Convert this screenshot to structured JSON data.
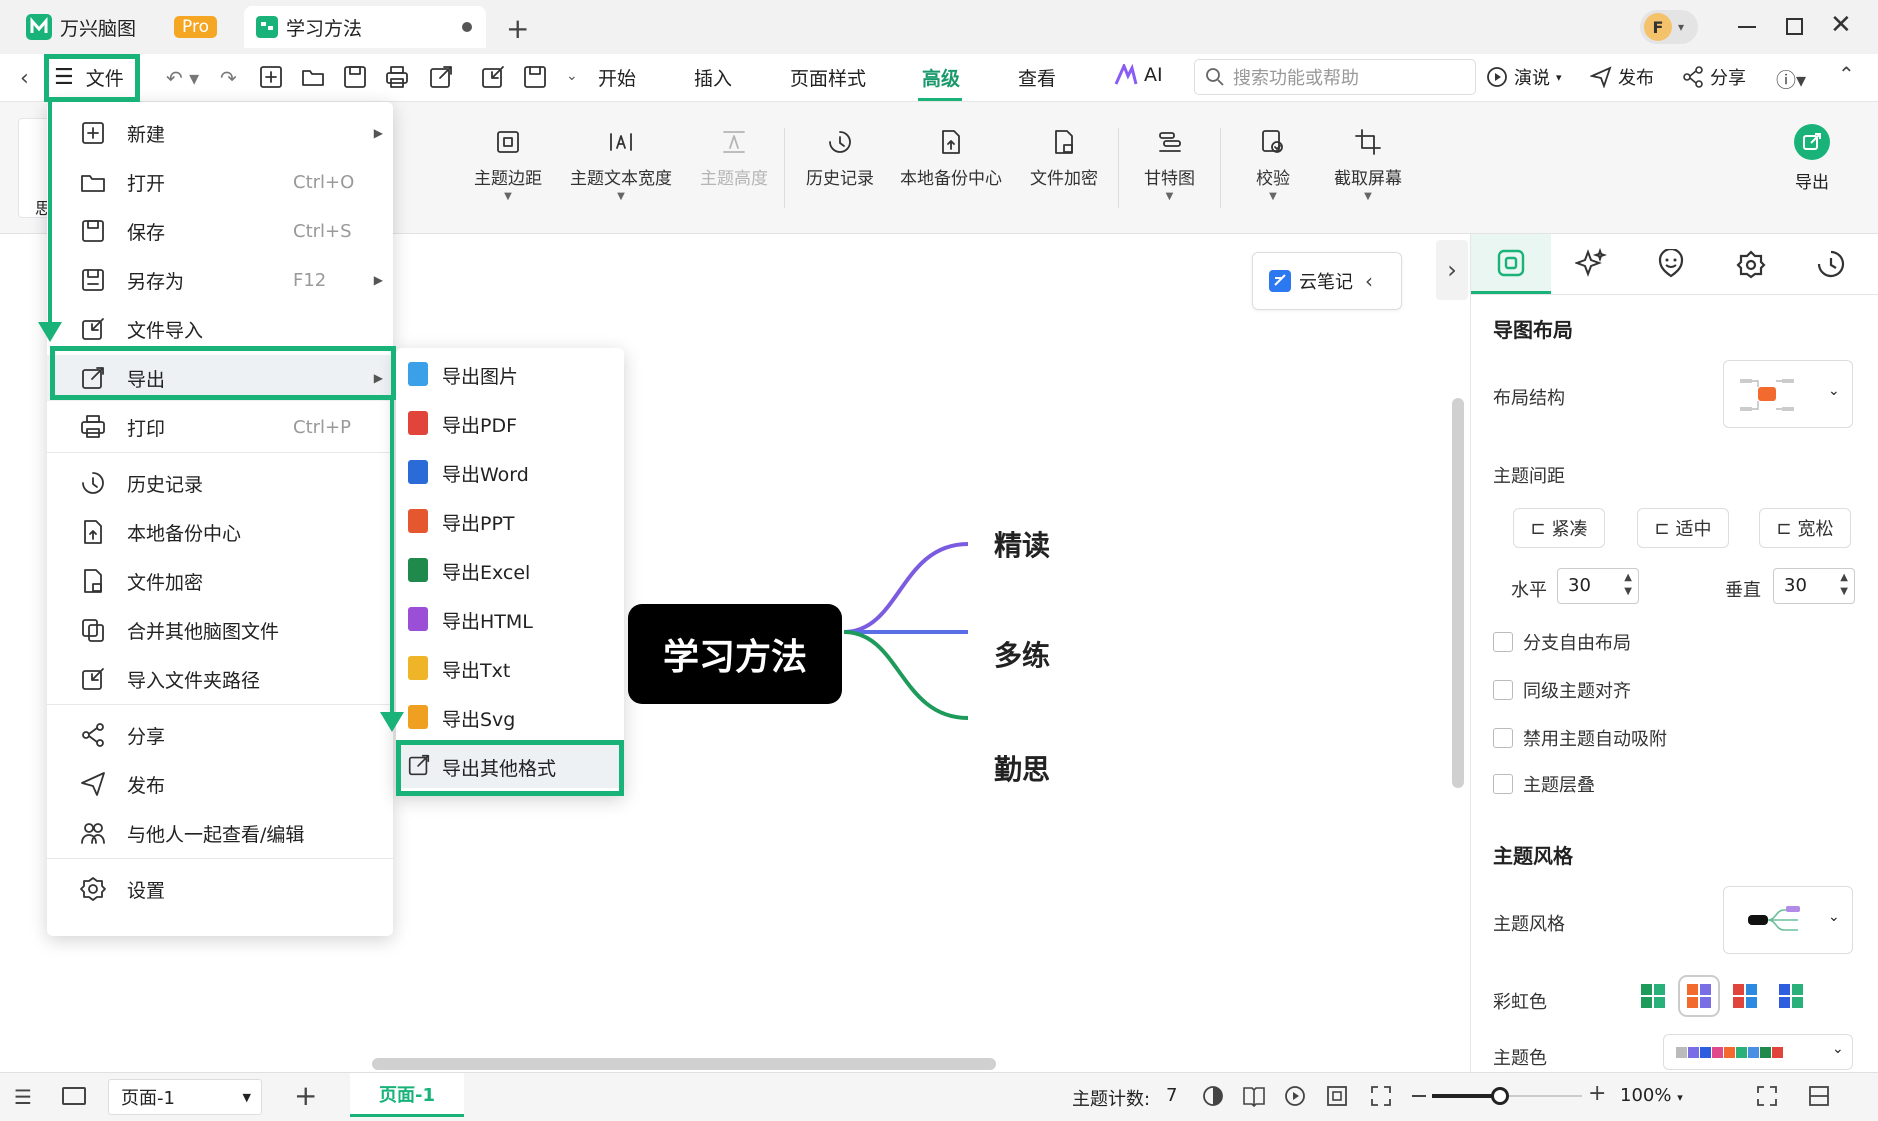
{
  "app": {
    "name": "万兴脑图",
    "badge": "Pro",
    "doc_tab": "学习方法",
    "avatar_letter": "F"
  },
  "toolbar": {
    "file_label": "文件",
    "tabs": [
      "开始",
      "插入",
      "页面样式",
      "高级",
      "查看"
    ],
    "active_tab": "高级",
    "ai_label": "AI",
    "search_placeholder": "搜索功能或帮助",
    "present_label": "演说",
    "publish_label": "发布",
    "share_label": "分享"
  },
  "ribbon": {
    "items": [
      {
        "label": "主题边距",
        "icon": "topic-margin-icon"
      },
      {
        "label": "主题文本宽度",
        "icon": "text-width-icon"
      },
      {
        "label": "主题高度",
        "icon": "topic-height-icon"
      },
      {
        "label": "历史记录",
        "icon": "history-icon"
      },
      {
        "label": "本地备份中心",
        "icon": "backup-icon"
      },
      {
        "label": "文件加密",
        "icon": "encrypt-icon"
      },
      {
        "label": "甘特图",
        "icon": "gantt-icon"
      },
      {
        "label": "校验",
        "icon": "check-icon"
      },
      {
        "label": "截取屏幕",
        "icon": "crop-icon"
      }
    ],
    "export_label": "导出",
    "left_fragment": "思"
  },
  "file_menu": {
    "items": [
      {
        "label": "新建",
        "shortcut": "",
        "icon": "new-icon"
      },
      {
        "label": "打开",
        "shortcut": "Ctrl+O",
        "icon": "open-icon"
      },
      {
        "label": "保存",
        "shortcut": "Ctrl+S",
        "icon": "save-icon"
      },
      {
        "label": "另存为",
        "shortcut": "F12",
        "icon": "save-as-icon"
      },
      {
        "label": "文件导入",
        "shortcut": "",
        "icon": "import-icon"
      },
      {
        "label": "导出",
        "shortcut": "",
        "icon": "export-icon"
      },
      {
        "label": "打印",
        "shortcut": "Ctrl+P",
        "icon": "print-icon"
      },
      {
        "label": "历史记录",
        "shortcut": "",
        "icon": "history-icon"
      },
      {
        "label": "本地备份中心",
        "shortcut": "",
        "icon": "backup-icon"
      },
      {
        "label": "文件加密",
        "shortcut": "",
        "icon": "encrypt-icon"
      },
      {
        "label": "合并其他脑图文件",
        "shortcut": "",
        "icon": "merge-icon"
      },
      {
        "label": "导入文件夹路径",
        "shortcut": "",
        "icon": "folder-import-icon"
      },
      {
        "label": "分享",
        "shortcut": "",
        "icon": "share-icon"
      },
      {
        "label": "发布",
        "shortcut": "",
        "icon": "publish-icon"
      },
      {
        "label": "与他人一起查看/编辑",
        "shortcut": "",
        "icon": "collab-icon"
      },
      {
        "label": "设置",
        "shortcut": "",
        "icon": "settings-icon"
      }
    ]
  },
  "export_menu": {
    "items": [
      {
        "label": "导出图片",
        "color": "#3aa0e8"
      },
      {
        "label": "导出PDF",
        "color": "#e0443a"
      },
      {
        "label": "导出Word",
        "color": "#2b6bd8"
      },
      {
        "label": "导出PPT",
        "color": "#e5572e"
      },
      {
        "label": "导出Excel",
        "color": "#1f8a4c"
      },
      {
        "label": "导出HTML",
        "color": "#9b4fd6"
      },
      {
        "label": "导出Txt",
        "color": "#f0b429"
      },
      {
        "label": "导出Svg",
        "color": "#f0a020"
      },
      {
        "label": "导出其他格式",
        "color": ""
      }
    ]
  },
  "mindmap": {
    "root": "学习方法",
    "branches": [
      "精读",
      "多练",
      "勤思"
    ]
  },
  "cloud_note": "云笔记",
  "panel": {
    "layout_title": "导图布局",
    "layout_struct": "布局结构",
    "spacing": "主题间距",
    "spacing_options": [
      "紧凑",
      "适中",
      "宽松"
    ],
    "horizontal_label": "水平",
    "horizontal_value": "30",
    "vertical_label": "垂直",
    "vertical_value": "30",
    "checkboxes": [
      "分支自由布局",
      "同级主题对齐",
      "禁用主题自动吸附",
      "主题层叠"
    ],
    "style_title": "主题风格",
    "style_label": "主题风格",
    "rainbow_label": "彩虹色",
    "theme_color_label": "主题色"
  },
  "status": {
    "page_select": "页面-1",
    "page_tab": "页面-1",
    "topic_count_label": "主题计数:",
    "topic_count": "7",
    "zoom": "100%",
    "zoom_level": 0.45
  },
  "colors": {
    "accent": "#19b37a",
    "branch_purple": "#7b5ce0",
    "branch_blue": "#5a6ee8",
    "branch_green": "#1e9a5a"
  }
}
